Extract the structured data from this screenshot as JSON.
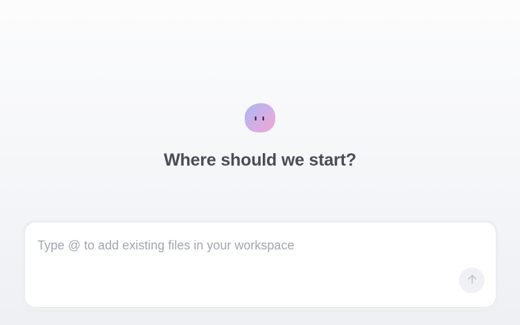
{
  "hero": {
    "mascot_icon": "blob-face-icon",
    "title": "Where should we start?"
  },
  "composer": {
    "placeholder": "Type @ to add existing files in your workspace",
    "value": "",
    "send_icon": "arrow-up-icon"
  },
  "colors": {
    "title": "#4a4d57",
    "placeholder": "#a2a6b0",
    "send_button_bg": "#f0f1f4",
    "send_arrow": "#c3c6cd",
    "mascot_gradient_start": "#a9b6f5",
    "mascot_gradient_end": "#f1a6d0"
  }
}
